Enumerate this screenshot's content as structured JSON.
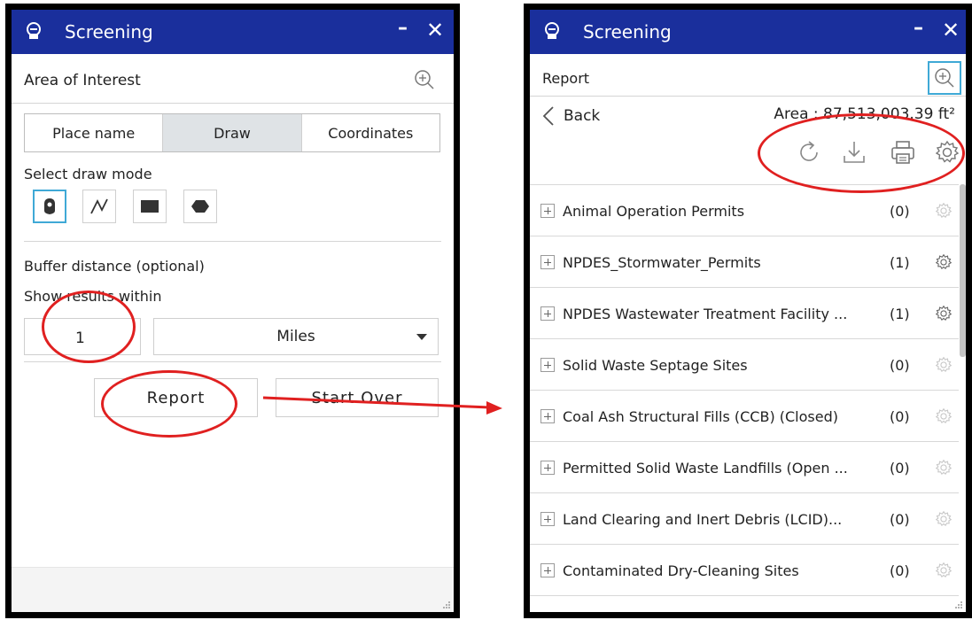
{
  "left_panel": {
    "title": "Screening",
    "minimize": "–",
    "close": "✕",
    "section_title": "Area of Interest",
    "tabs": [
      {
        "label": "Place name",
        "active": false
      },
      {
        "label": "Draw",
        "active": true
      },
      {
        "label": "Coordinates",
        "active": false
      }
    ],
    "draw_mode_label": "Select draw mode",
    "draw_modes": [
      "point",
      "polyline",
      "rectangle",
      "polygon"
    ],
    "selected_mode": "point",
    "buffer_label": "Buffer distance (optional)",
    "show_results_label": "Show results within",
    "distance_value": "1",
    "unit_value": "Miles",
    "report_button": "Report",
    "start_over_button": "Start Over"
  },
  "right_panel": {
    "title": "Screening",
    "minimize": "–",
    "close": "✕",
    "section_title": "Report",
    "back_label": "Back",
    "area_text": "Area : 87,513,003.39 ft²",
    "tools": [
      "refresh-icon",
      "download-icon",
      "print-icon",
      "settings-icon"
    ],
    "layers": [
      {
        "name": "Animal Operation Permits",
        "count": "(0)",
        "active": false
      },
      {
        "name": "NPDES_Stormwater_Permits",
        "count": "(1)",
        "active": true
      },
      {
        "name": "NPDES Wastewater Treatment Facility ...",
        "count": "(1)",
        "active": true
      },
      {
        "name": "Solid Waste Septage Sites",
        "count": "(0)",
        "active": false
      },
      {
        "name": "Coal Ash Structural Fills (CCB) (Closed)",
        "count": "(0)",
        "active": false
      },
      {
        "name": "Permitted Solid Waste Landfills (Open ...",
        "count": "(0)",
        "active": false
      },
      {
        "name": "Land Clearing and Inert Debris (LCID)...",
        "count": "(0)",
        "active": false
      },
      {
        "name": "Contaminated Dry-Cleaning Sites",
        "count": "(0)",
        "active": false
      }
    ]
  },
  "colors": {
    "titlebar": "#1a2f9c",
    "annotation": "#e02020",
    "selected_border": "#3fa9d6"
  }
}
